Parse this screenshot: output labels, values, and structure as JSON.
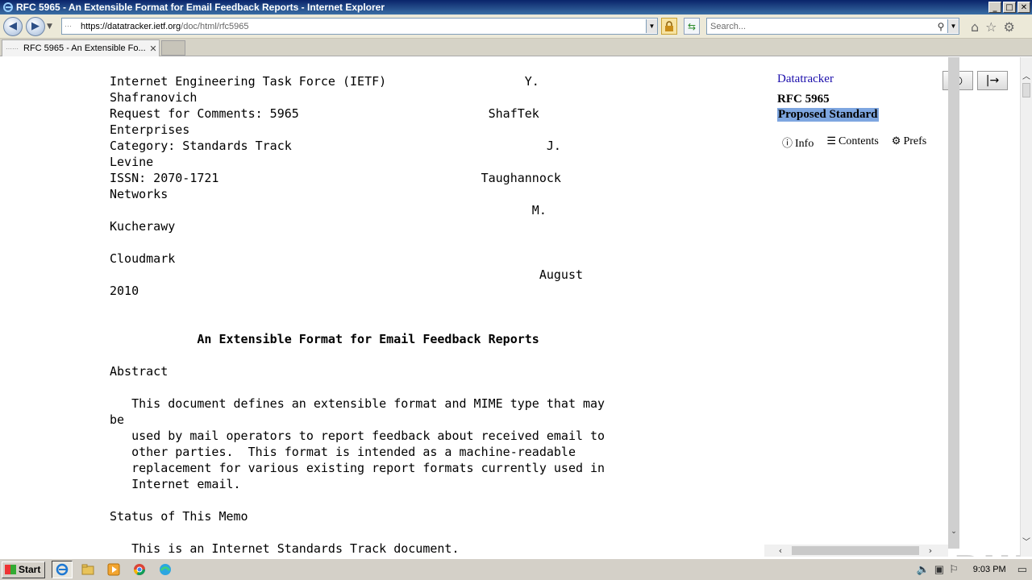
{
  "window": {
    "title": "RFC 5965 - An Extensible Format for Email Feedback Reports - Internet Explorer",
    "min_label": "_",
    "max_label": "□",
    "close_label": "✕"
  },
  "nav": {
    "back_icon": "◀",
    "forward_icon": "▶",
    "url_prefix": "https://",
    "url_host": "datatracker.ietf.org",
    "url_path": "/doc/html/rfc5965",
    "search_placeholder": "Search..."
  },
  "tab": {
    "label": "RFC 5965 - An Extensible Fo...",
    "close": "✕"
  },
  "document": {
    "lines": [
      "Internet Engineering Task Force (IETF)                   Y.",
      "Shafranovich",
      "Request for Comments: 5965                          ShafTek",
      "Enterprises",
      "Category: Standards Track                                   J.",
      "Levine",
      "ISSN: 2070-1721                                    Taughannock",
      "Networks",
      "                                                          M.",
      "Kucherawy",
      "",
      "Cloudmark",
      "                                                           August",
      "2010",
      "",
      "",
      "            An Extensible Format for Email Feedback Reports",
      "",
      "Abstract",
      "",
      "   This document defines an extensible format and MIME type that may",
      "be",
      "   used by mail operators to report feedback about received email to",
      "   other parties.  This format is intended as a machine-readable",
      "   replacement for various existing report formats currently used in",
      "   Internet email.",
      "",
      "Status of This Memo",
      "",
      "   This is an Internet Standards Track document."
    ],
    "title_line_index": 16
  },
  "sidebar": {
    "datatracker": "Datatracker",
    "rfc_number": "RFC 5965",
    "status": "Proposed Standard",
    "links": [
      {
        "icon": "ⓘ",
        "label": "Info"
      },
      {
        "icon": "☰",
        "label": "Contents"
      },
      {
        "icon": "⚙",
        "label": "Prefs"
      }
    ],
    "theme_button": "◐",
    "collapse_button": "|→"
  },
  "watermark": "ANY▷RUN",
  "taskbar": {
    "start_label": "Start",
    "clock": "9:03 PM"
  }
}
